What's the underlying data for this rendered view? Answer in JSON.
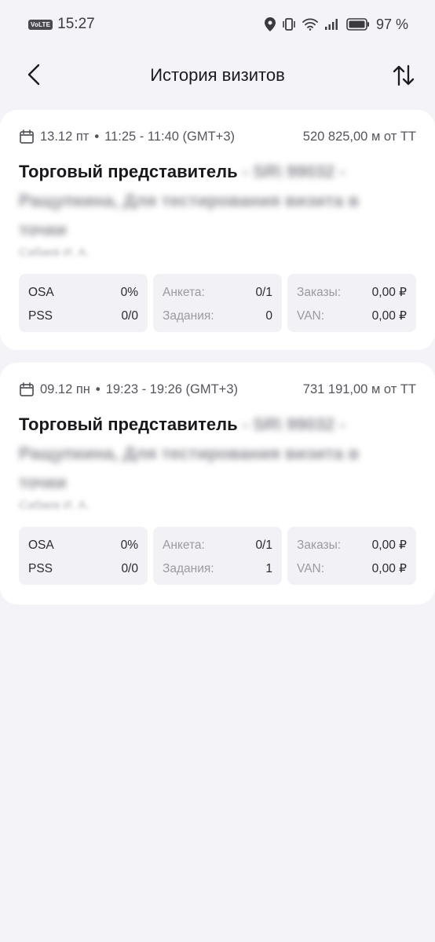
{
  "status_bar": {
    "network_badge": "VoLTE",
    "time": "15:27",
    "battery": "97 %"
  },
  "header": {
    "title": "История визитов"
  },
  "visits": [
    {
      "date": "13.12 пт",
      "time_range": "11:25 - 11:40 (GMT+3)",
      "distance": "520 825,00 м от ТТ",
      "title": "Торговый представитель",
      "title_blurred": "- SR\\ 99032 - Ращупкина, Для тестирования визита в точки",
      "subtitle_blurred": "Сабаев И. А.",
      "stats": {
        "osa_label": "OSA",
        "osa_value": "0%",
        "pss_label": "PSS",
        "pss_value": "0/0",
        "anketa_label": "Анкета:",
        "anketa_value": "0/1",
        "zadaniya_label": "Задания:",
        "zadaniya_value": "0",
        "zakazy_label": "Заказы:",
        "zakazy_value": "0,00 ₽",
        "van_label": "VAN:",
        "van_value": "0,00 ₽"
      }
    },
    {
      "date": "09.12 пн",
      "time_range": "19:23 - 19:26 (GMT+3)",
      "distance": "731 191,00 м от ТТ",
      "title": "Торговый представитель",
      "title_blurred": "- SR\\ 99032 - Ращупкина, Для тестирования визита в точки",
      "subtitle_blurred": "Сабаев И. А.",
      "stats": {
        "osa_label": "OSA",
        "osa_value": "0%",
        "pss_label": "PSS",
        "pss_value": "0/0",
        "anketa_label": "Анкета:",
        "anketa_value": "0/1",
        "zadaniya_label": "Задания:",
        "zadaniya_value": "1",
        "zakazy_label": "Заказы:",
        "zakazy_value": "0,00 ₽",
        "van_label": "VAN:",
        "van_value": "0,00 ₽"
      }
    }
  ],
  "icons": {
    "back": "chevron-left-icon",
    "sort": "sort-arrows-icon",
    "calendar": "calendar-icon",
    "location": "location-pin-icon",
    "vibrate": "vibrate-icon",
    "wifi": "wifi-icon",
    "signal": "signal-icon",
    "battery": "battery-icon"
  },
  "colors": {
    "background": "#f3f3f8",
    "card": "#ffffff",
    "stat_box": "#f2f2f6"
  }
}
